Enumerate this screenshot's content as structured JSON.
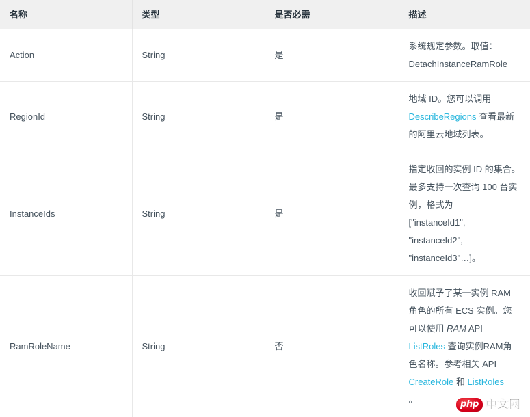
{
  "table": {
    "headers": [
      {
        "label": "名称"
      },
      {
        "label": "类型"
      },
      {
        "label": "是否必需"
      },
      {
        "label": "描述"
      }
    ],
    "rows": [
      {
        "name": "Action",
        "type": "String",
        "required": "是",
        "desc": {
          "line1": "系统规定参数。取值：",
          "line2": "DetachInstanceRamRole"
        }
      },
      {
        "name": "RegionId",
        "type": "String",
        "required": "是",
        "desc": {
          "part1": "地域 ID。您可以调用 ",
          "link1": "DescribeRegions",
          "part2": " 查看最新的阿里云地域列表。"
        }
      },
      {
        "name": "InstanceIds",
        "type": "String",
        "required": "是",
        "desc": {
          "part1": "指定收回的实例 ID 的集合。最多支持一次查询 100 台实例，格式为",
          "code1": "[\"instanceId1\",",
          "code2": "\"instanceId2\",",
          "code3": "\"instanceId3\"…]",
          "tail": "。"
        }
      },
      {
        "name": "RamRoleName",
        "type": "String",
        "required": "否",
        "desc": {
          "part1": "收回赋予了某一实例 RAM 角色的所有 ECS 实例。您可以使用 ",
          "italic1": "RAM",
          "part2": " API ",
          "link1": "ListRoles",
          "part3": " 查询实例RAM角色名称。参考相关 API ",
          "link2": "CreateRole",
          "part4": " 和 ",
          "link3": "ListRoles",
          "tail": "。"
        }
      }
    ]
  },
  "watermark": {
    "badge_text": "php",
    "site_text": "中文网",
    "badge_color": "#d9001b"
  },
  "colors": {
    "link": "#29b7de",
    "header_bg": "#f0f0f0",
    "border": "#e8e8e8",
    "text": "#46535e"
  }
}
